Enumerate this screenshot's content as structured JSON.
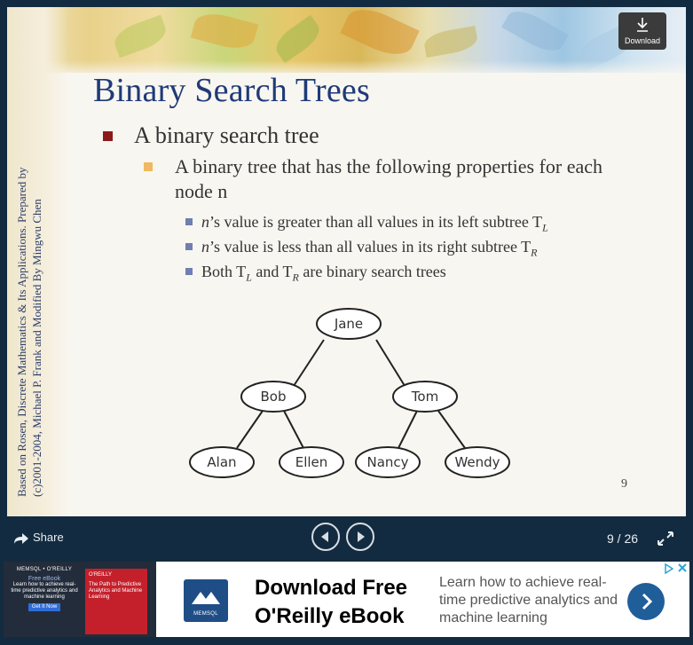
{
  "slide": {
    "title": "Binary Search Trees",
    "side_credit_line1": "Based on Rosen, Discrete Mathematics & Its Applications. Prepared by",
    "side_credit_line2": "(c)2001-2004, Michael P. Frank and Modified By Mingwu Chen",
    "bullet1": "A binary search tree",
    "bullet2": "A binary tree that has the following properties for each node n",
    "sub1_pre": "’s value is greater than all values in its left subtree T",
    "sub1_sub": "L",
    "sub2_pre": "’s value is less than all values in its right subtree T",
    "sub2_sub": "R",
    "sub3_a": "Both T",
    "sub3_sub_a": "L",
    "sub3_b": " and T",
    "sub3_sub_b": "R",
    "sub3_c": " are binary search trees",
    "var_n": "n",
    "slide_number": "9",
    "tree": {
      "root": "Jane",
      "left": "Bob",
      "right": "Tom",
      "left_left": "Alan",
      "left_right": "Ellen",
      "right_left": "Nancy",
      "right_right": "Wendy"
    }
  },
  "download": {
    "label": "Download",
    "icon": "download-icon"
  },
  "controls": {
    "share_label": "Share",
    "page_current": "9",
    "page_total": "26",
    "page_counter": "9 / 26"
  },
  "ad": {
    "thumb_brand": "MEMSQL • O'REILLY",
    "thumb_free": "Free eBook",
    "thumb_desc": "Learn how to achieve real-time predictive analytics and machine learning",
    "thumb_btn": "Get It Now",
    "book_publisher": "O'REILLY",
    "book_title": "The Path to Predictive Analytics and Machine Learning",
    "logo_text": "MEMSQL",
    "headline": "Download Free O'Reilly eBook",
    "body": "Learn how to achieve real-time predictive analytics and machine learning"
  },
  "colors": {
    "title": "#1f3a78",
    "bullet_level1": "#8b1a1a",
    "bullet_level2": "#f0b860",
    "bullet_level3": "#6f7fb0",
    "viewer_bg": "#132b40",
    "ad_arrow": "#1f5e99"
  }
}
